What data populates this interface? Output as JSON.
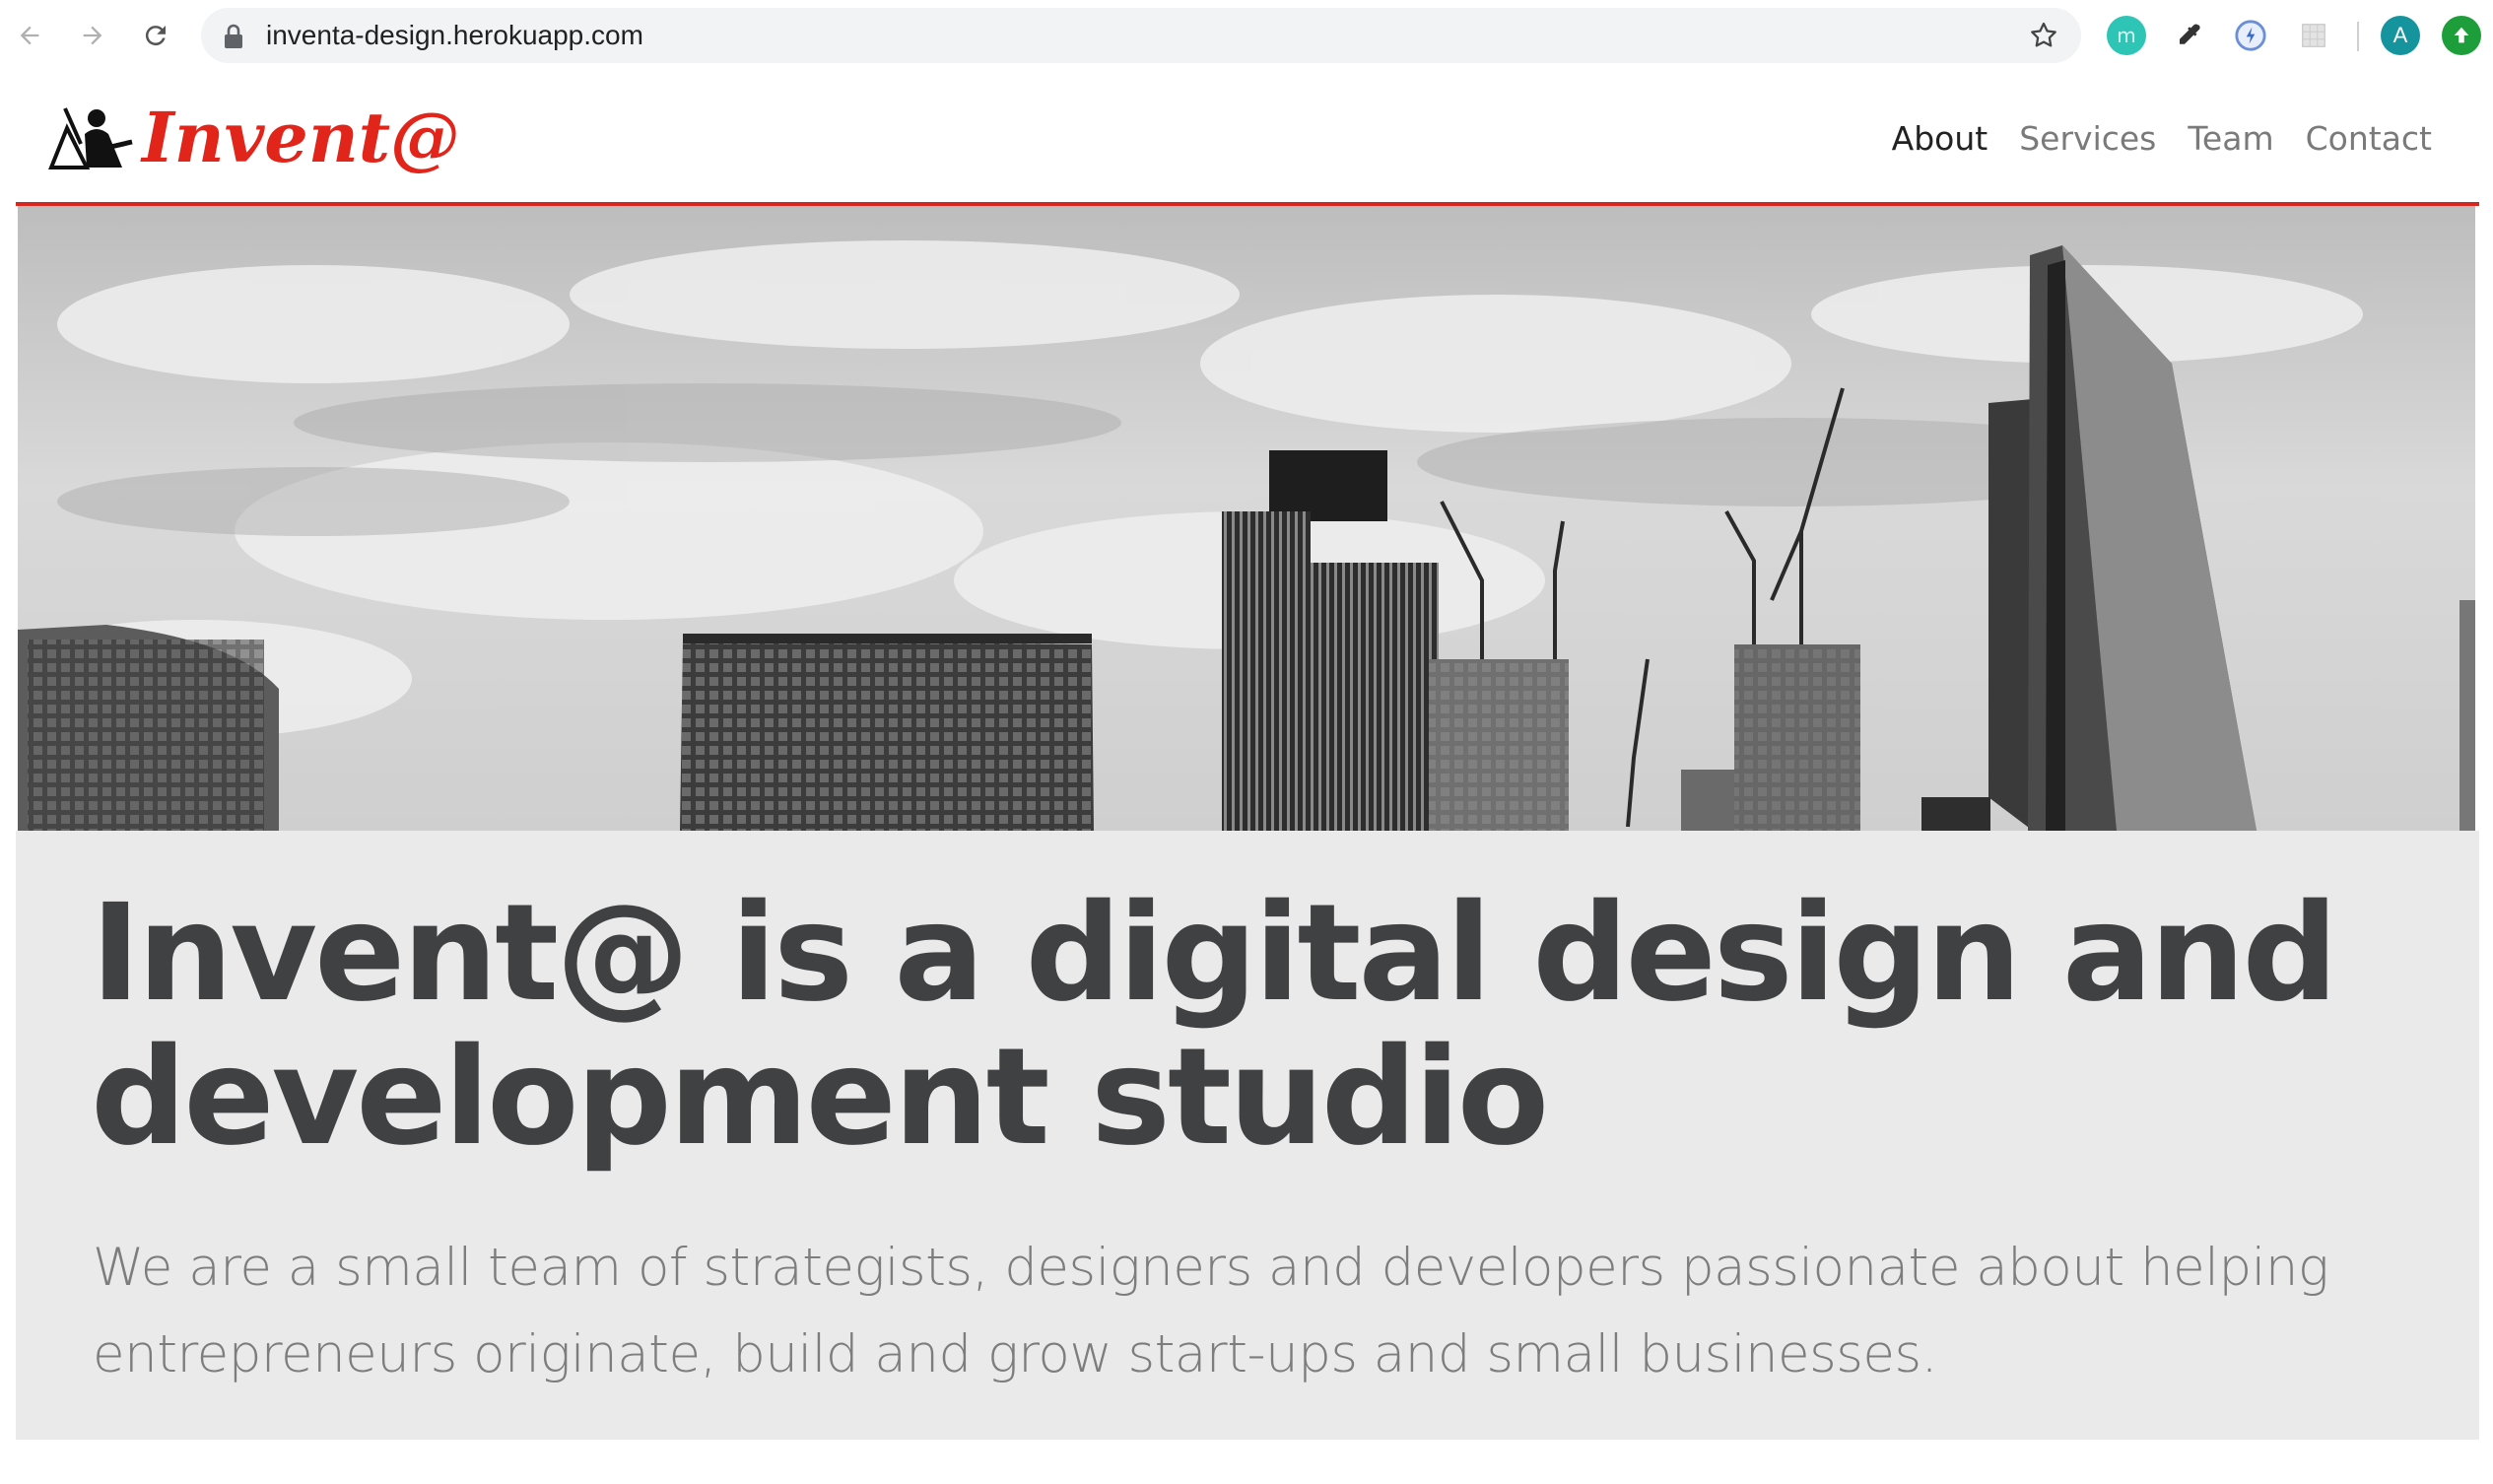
{
  "browser": {
    "url": "inventa-design.herokuapp.com",
    "profile_initial": "A",
    "extension_m_letter": "m"
  },
  "site": {
    "logo_text": "Invent@",
    "nav": [
      {
        "label": "About",
        "active": true
      },
      {
        "label": "Services",
        "active": false
      },
      {
        "label": "Team",
        "active": false
      },
      {
        "label": "Contact",
        "active": false
      }
    ]
  },
  "hero": {
    "image_alt": "Black and white city skyline with construction cranes",
    "headline": "Invent@ is a digital design and development studio",
    "subline": "We are a small team of strategists, designers and developers passionate about helping entrepreneurs originate, build and grow start-ups and small businesses."
  },
  "colors": {
    "brand_red": "#e1251b",
    "headline": "#404142",
    "hero_band": "#ebeaeb"
  }
}
